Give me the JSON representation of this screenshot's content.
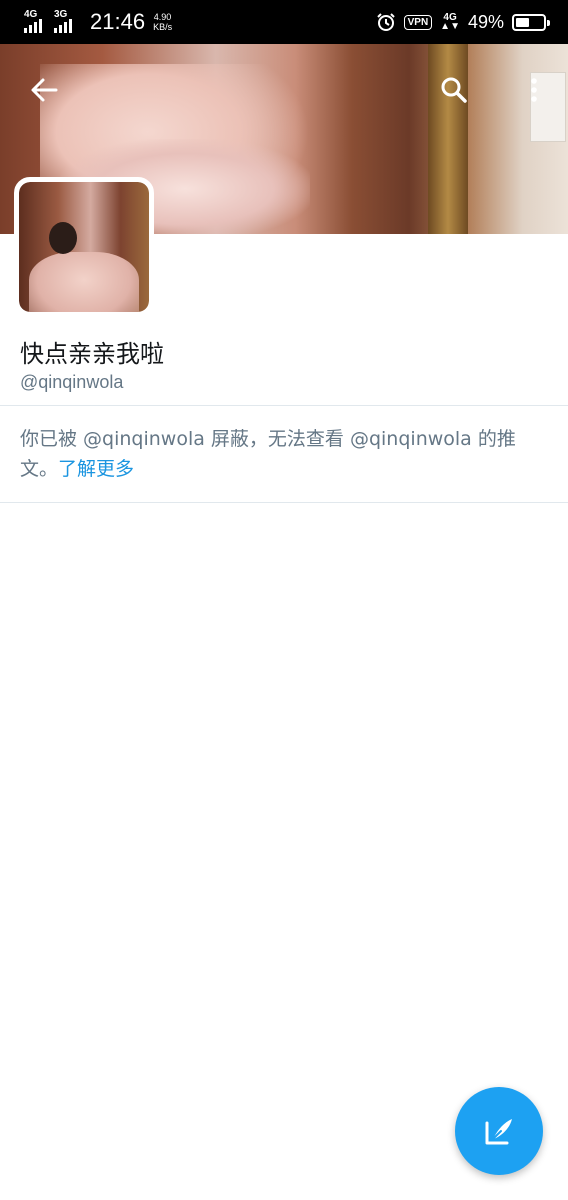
{
  "status_bar": {
    "signal1_label": "4G",
    "signal2_label": "3G",
    "time": "21:46",
    "speed_value": "4.90",
    "speed_unit": "KB/s",
    "vpn_label": "VPN",
    "net_label": "4G",
    "battery_percent": "49%",
    "battery_level": 0.49
  },
  "header": {
    "back_icon": "arrow-left-icon",
    "search_icon": "search-icon",
    "more_icon": "more-vertical-icon"
  },
  "profile": {
    "display_name": "快点亲亲我啦",
    "handle": "@qinqinwola"
  },
  "blocked_notice": {
    "text": "你已被 @qinqinwola 屏蔽，无法查看 @qinqinwola 的推文。",
    "link_label": "了解更多"
  },
  "fab": {
    "icon": "compose-tweet-icon"
  },
  "colors": {
    "accent": "#1da1f2",
    "link": "#1b95e0",
    "secondary_text": "#657786",
    "primary_text": "#14171a",
    "divider": "#e1e8ed"
  }
}
